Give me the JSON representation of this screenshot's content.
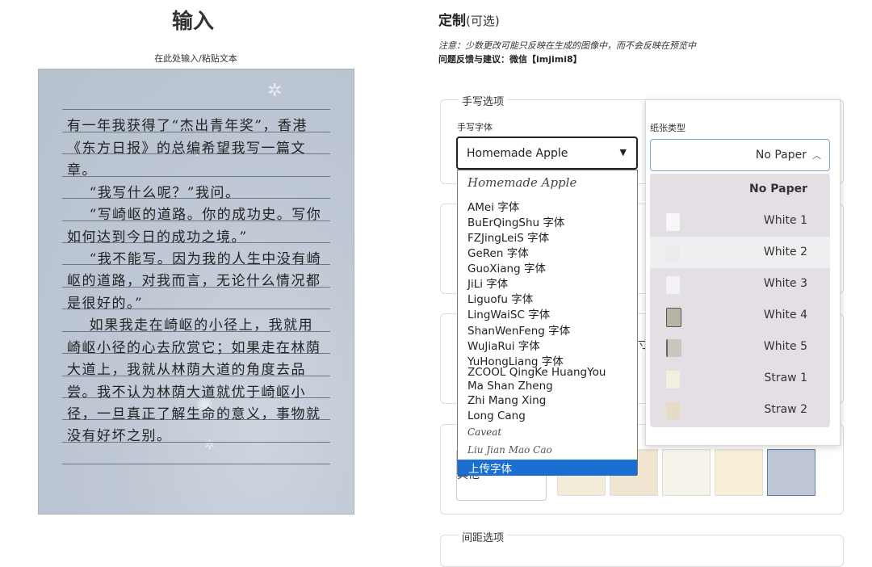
{
  "input": {
    "title": "输入",
    "hint": "在此处输入/粘贴文本",
    "lines": [
      "有一年我获得了“杰出青年奖”，香港",
      "《东方日报》的总编希望我写一篇文",
      "章。",
      "    “我写什么呢？”我问。",
      "    “写崎岖的道路。你的成功史。写你",
      "如何达到今日的成功之境。”",
      "    “我不能写。因为我的人生中没有崎",
      "岖的道路，对我而言，无论什么情况都",
      "是很好的。”",
      "    如果我走在崎岖的小径上，我就用",
      "崎岖小径的心去欣赏它；如果走在林荫",
      "大道上，我就从林荫大道的角度去品",
      "尝。我不认为林荫大道就优于崎岖小",
      "径，一旦真正了解生命的意义，事物就",
      "没有好坏之别。"
    ]
  },
  "customize": {
    "title": "定制",
    "title_suffix": "(可选)",
    "note": "注意：少数更改可能只反映在生成的图像中，而不会反映在预览中",
    "feedback": "问题反馈与建议：微信【imjimi8】",
    "handwriting_legend": "手写选项",
    "font_label": "手写字体",
    "font_value": "Homemade Apple",
    "paper_type_label": "纸张类型",
    "paper_value": "No Paper",
    "spacing_legend": "间距选项",
    "partial_text": "寸",
    "other_button": "其他"
  },
  "font_options": [
    "Homemade Apple",
    "AMei 字体",
    "BuErQingShu 字体",
    "FZJingLeiS 字体",
    "GeRen 字体",
    "GuoXiang 字体",
    "JiLi 字体",
    "Liguofu 字体",
    "LingWaiSC 字体",
    "ShanWenFeng 字体",
    "WuJiaRui 字体",
    "YuHongLiang 字体",
    "ZCOOL QingKe HuangYou",
    "Ma Shan Zheng",
    "Zhi Mang Xing",
    "Long Cang",
    "Caveat",
    "Liu Jian Mao Cao",
    "上传字体"
  ],
  "selected_font_option": "上传字体",
  "paper_options": [
    {
      "label": "No Paper",
      "color": "#e3dfe5"
    },
    {
      "label": "White 1",
      "color": "#f7f7f8"
    },
    {
      "label": "White 2",
      "color": "#ececee"
    },
    {
      "label": "White 3",
      "color": "#f2f2f4"
    },
    {
      "label": "White 4",
      "color": "#b9b3a6"
    },
    {
      "label": "White 5",
      "color": "#c9c6c0"
    },
    {
      "label": "Straw 1",
      "color": "#f3efdd"
    },
    {
      "label": "Straw 2",
      "color": "#e6dcc6"
    }
  ],
  "hovered_paper": "White 2",
  "colors": {
    "selection_blue": "#1a6fd1",
    "paper_bg": "#bfc8d4",
    "dropdown_bg": "#e3dfe5"
  }
}
